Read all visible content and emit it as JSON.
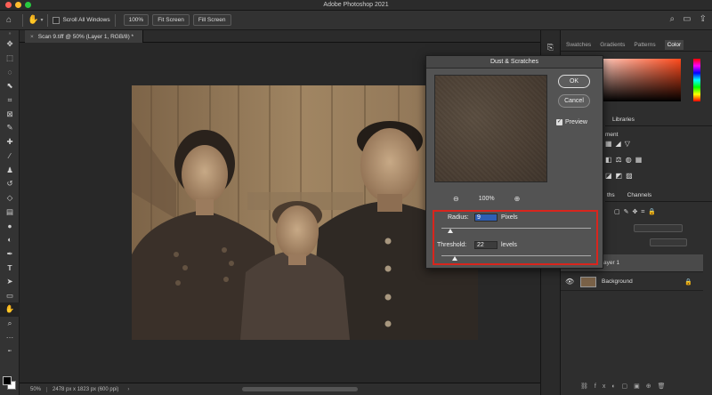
{
  "app": {
    "title": "Adobe Photoshop 2021"
  },
  "options": {
    "scroll_all_windows": "Scroll All Windows",
    "zoom_100": "100%",
    "fit_screen": "Fit Screen",
    "fill_screen": "Fill Screen"
  },
  "document": {
    "tab_title": "Scan 9.tiff @ 50% (Layer 1, RGB/8) *"
  },
  "status": {
    "zoom": "50%",
    "dimensions": "2478 px x 1823 px (600 ppi)"
  },
  "dialog": {
    "title": "Dust & Scratches",
    "ok_label": "OK",
    "cancel_label": "Cancel",
    "preview_label": "Preview",
    "preview_checked": true,
    "zoom_level": "100%",
    "radius_label": "Radius:",
    "radius_value": "9",
    "radius_unit": "Pixels",
    "radius_slider_pct": 6,
    "threshold_label": "Threshold:",
    "threshold_value": "22",
    "threshold_unit": "levels",
    "threshold_slider_pct": 9
  },
  "panels": {
    "tabs": [
      "Swatches",
      "Gradients",
      "Patterns",
      "Color"
    ],
    "active_tab": "Color",
    "libraries_tab": "Libraries",
    "adjustments_label": "ment",
    "layers_tab_fragment": "ths",
    "channels_tab": "Channels",
    "layers": [
      "ayer 1",
      "Background"
    ]
  },
  "colors": {
    "accent_red": "#d9251d",
    "selected_hue": "#ff4a1c"
  }
}
